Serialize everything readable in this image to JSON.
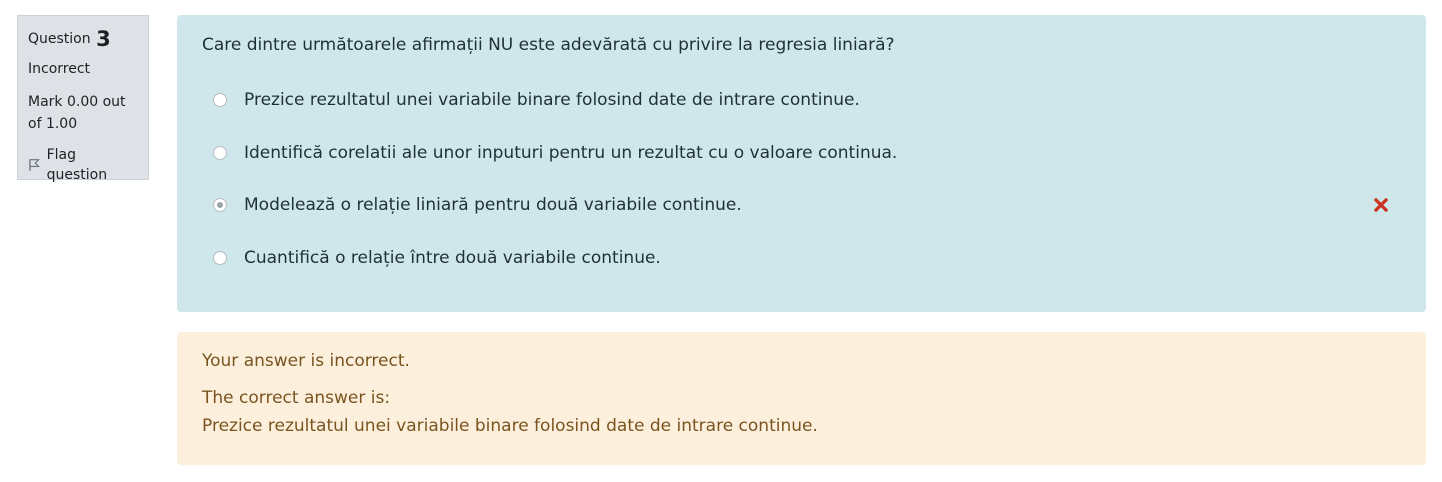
{
  "info": {
    "question_label": "Question",
    "question_number": "3",
    "state": "Incorrect",
    "grade": "Mark 0.00 out of 1.00",
    "flag_label": "Flag question"
  },
  "question": {
    "text": "Care dintre următoarele afirmații NU este adevărată cu privire la regresia liniară?",
    "answers": [
      {
        "label": "Prezice rezultatul unei variabile binare folosind date de intrare continue.",
        "selected": false
      },
      {
        "label": "Identifică corelatii ale unor inputuri pentru un rezultat cu o valoare continua.",
        "selected": false
      },
      {
        "label": "Modelează o relație liniară pentru două variabile continue.",
        "selected": true
      },
      {
        "label": "Cuantifică o relație între două variabile continue.",
        "selected": false
      }
    ]
  },
  "feedback": {
    "result": "Your answer is incorrect.",
    "correct_label": "The correct answer is:",
    "correct_answer": "Prezice rezultatul unei variabile binare folosind date de intrare continue."
  },
  "colors": {
    "info_bg": "#dee2e6",
    "formulation_bg": "#cfe6ea",
    "feedback_bg": "#fcefdc",
    "feedback_text": "#7a5420",
    "incorrect_icon": "#ca3120"
  }
}
